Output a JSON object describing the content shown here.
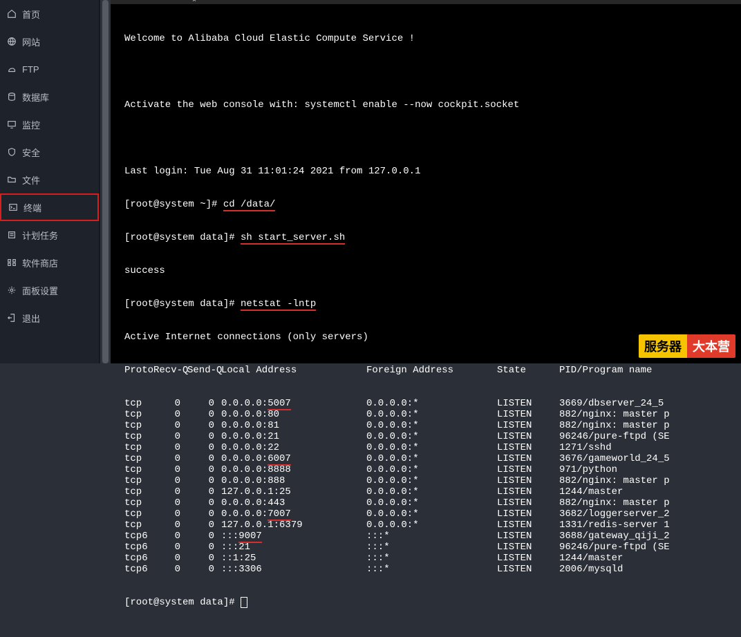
{
  "sidebar": {
    "items": [
      {
        "label": "首页",
        "icon": "home"
      },
      {
        "label": "网站",
        "icon": "globe"
      },
      {
        "label": "FTP",
        "icon": "ftp"
      },
      {
        "label": "数据库",
        "icon": "db"
      },
      {
        "label": "监控",
        "icon": "monitor"
      },
      {
        "label": "安全",
        "icon": "shield"
      },
      {
        "label": "文件",
        "icon": "folder"
      },
      {
        "label": "终端",
        "icon": "terminal",
        "active": true
      },
      {
        "label": "计划任务",
        "icon": "task"
      },
      {
        "label": "软件商店",
        "icon": "store"
      },
      {
        "label": "面板设置",
        "icon": "settings"
      },
      {
        "label": "退出",
        "icon": "logout"
      }
    ]
  },
  "terminal": {
    "welcome": "Welcome to Alibaba Cloud Elastic Compute Service !",
    "activate": "Activate the web console with: systemctl enable --now cockpit.socket",
    "last_login": "Last login: Tue Aug 31 11:01:24 2021 from 127.0.0.1",
    "prompt1_left": "[root@system ~]# ",
    "cmd1": "cd /data/",
    "prompt2_left": "[root@system data]# ",
    "cmd2": "sh start_server.sh",
    "success": "success",
    "prompt3_left": "[root@system data]# ",
    "cmd3": "netstat -lntp",
    "active_conn": "Active Internet connections (only servers)",
    "hdr_proto": "Proto",
    "hdr_rq": "Recv-Q",
    "hdr_sq": "Send-Q",
    "hdr_local": "Local Address",
    "hdr_foreign": "Foreign Address",
    "hdr_state": "State",
    "hdr_pid": "PID/Program name",
    "rows": [
      {
        "proto": "tcp",
        "rq": "0",
        "sq": "0",
        "local": "0.0.0.0:5007",
        "foreign": "0.0.0.0:*",
        "state": "LISTEN",
        "pid": "3669/dbserver_24_5",
        "ul": "5007"
      },
      {
        "proto": "tcp",
        "rq": "0",
        "sq": "0",
        "local": "0.0.0.0:80",
        "foreign": "0.0.0.0:*",
        "state": "LISTEN",
        "pid": "882/nginx: master p"
      },
      {
        "proto": "tcp",
        "rq": "0",
        "sq": "0",
        "local": "0.0.0.0:81",
        "foreign": "0.0.0.0:*",
        "state": "LISTEN",
        "pid": "882/nginx: master p"
      },
      {
        "proto": "tcp",
        "rq": "0",
        "sq": "0",
        "local": "0.0.0.0:21",
        "foreign": "0.0.0.0:*",
        "state": "LISTEN",
        "pid": "96246/pure-ftpd (SE"
      },
      {
        "proto": "tcp",
        "rq": "0",
        "sq": "0",
        "local": "0.0.0.0:22",
        "foreign": "0.0.0.0:*",
        "state": "LISTEN",
        "pid": "1271/sshd"
      },
      {
        "proto": "tcp",
        "rq": "0",
        "sq": "0",
        "local": "0.0.0.0:6007",
        "foreign": "0.0.0.0:*",
        "state": "LISTEN",
        "pid": "3676/gameworld_24_5",
        "ul": "6007"
      },
      {
        "proto": "tcp",
        "rq": "0",
        "sq": "0",
        "local": "0.0.0.0:8888",
        "foreign": "0.0.0.0:*",
        "state": "LISTEN",
        "pid": "971/python"
      },
      {
        "proto": "tcp",
        "rq": "0",
        "sq": "0",
        "local": "0.0.0.0:888",
        "foreign": "0.0.0.0:*",
        "state": "LISTEN",
        "pid": "882/nginx: master p"
      },
      {
        "proto": "tcp",
        "rq": "0",
        "sq": "0",
        "local": "127.0.0.1:25",
        "foreign": "0.0.0.0:*",
        "state": "LISTEN",
        "pid": "1244/master"
      },
      {
        "proto": "tcp",
        "rq": "0",
        "sq": "0",
        "local": "0.0.0.0:443",
        "foreign": "0.0.0.0:*",
        "state": "LISTEN",
        "pid": "882/nginx: master p"
      },
      {
        "proto": "tcp",
        "rq": "0",
        "sq": "0",
        "local": "0.0.0.0:7007",
        "foreign": "0.0.0.0:*",
        "state": "LISTEN",
        "pid": "3682/loggerserver_2",
        "ul": "7007"
      },
      {
        "proto": "tcp",
        "rq": "0",
        "sq": "0",
        "local": "127.0.0.1:6379",
        "foreign": "0.0.0.0:*",
        "state": "LISTEN",
        "pid": "1331/redis-server 1"
      },
      {
        "proto": "tcp6",
        "rq": "0",
        "sq": "0",
        "local": ":::9007",
        "foreign": ":::*",
        "state": "LISTEN",
        "pid": "3688/gateway_qiji_2",
        "ul": "9007"
      },
      {
        "proto": "tcp6",
        "rq": "0",
        "sq": "0",
        "local": ":::21",
        "foreign": ":::*",
        "state": "LISTEN",
        "pid": "96246/pure-ftpd (SE"
      },
      {
        "proto": "tcp6",
        "rq": "0",
        "sq": "0",
        "local": "::1:25",
        "foreign": ":::*",
        "state": "LISTEN",
        "pid": "1244/master"
      },
      {
        "proto": "tcp6",
        "rq": "0",
        "sq": "0",
        "local": ":::3306",
        "foreign": ":::*",
        "state": "LISTEN",
        "pid": "2006/mysqld"
      }
    ],
    "prompt_end": "[root@system data]# "
  },
  "brand": {
    "b1": "服务器",
    "b2": "大本营"
  }
}
